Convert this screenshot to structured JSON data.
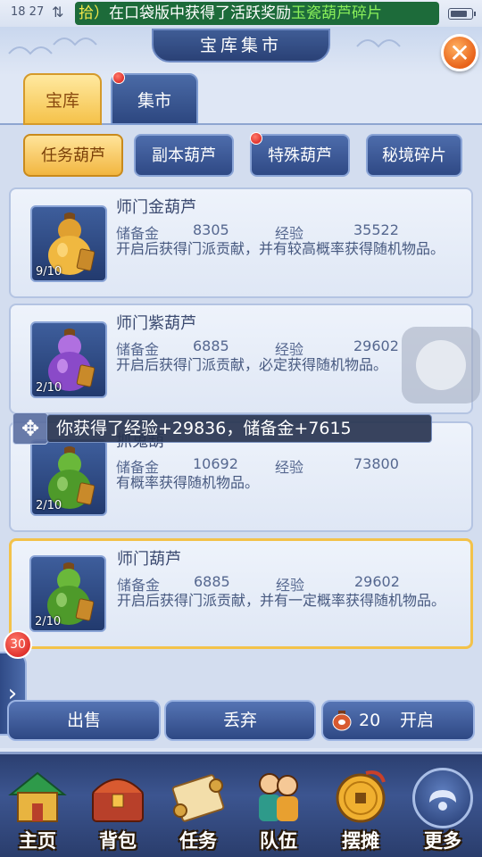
{
  "status_bar": {
    "time": "18 27",
    "network_icon": "updown-arrows-icon",
    "ticker_prefix": "拾）",
    "ticker_main": "在口袋版中获得了活跃奖励",
    "ticker_item": "玉瓷葫芦碎片"
  },
  "header": {
    "title": "宝库集市",
    "close_icon": "close-icon"
  },
  "top_tabs": [
    {
      "label": "宝库",
      "active": true
    },
    {
      "label": "集市",
      "active": false,
      "red_dot": true
    }
  ],
  "sub_tabs": [
    {
      "label": "任务葫芦",
      "active": true
    },
    {
      "label": "副本葫芦",
      "active": false
    },
    {
      "label": "特殊葫芦",
      "active": false,
      "red_dot": true
    },
    {
      "label": "秘境碎片",
      "active": false
    }
  ],
  "items": [
    {
      "name": "师门金葫芦",
      "count": "9/10",
      "reserve_label": "储备金",
      "reserve_value": "8305",
      "exp_label": "经验",
      "exp_value": "35522",
      "desc": "开启后获得门派贡献，并有较高概率获得随机物品。",
      "color": "#e0a030",
      "seal_text": "师"
    },
    {
      "name": "师门紫葫芦",
      "count": "2/10",
      "reserve_label": "储备金",
      "reserve_value": "6885",
      "exp_label": "经验",
      "exp_value": "29602",
      "desc": "开启后获得门派贡献，必定获得随机物品。",
      "color": "#9a5ad0",
      "seal_text": "师"
    },
    {
      "name": "抓鬼葫",
      "count": "2/10",
      "reserve_label": "储备金",
      "reserve_value": "10692",
      "exp_label": "经验",
      "exp_value": "73800",
      "desc": "有概率获得随机物品。",
      "color": "#5aa830",
      "seal_text": "鬼"
    },
    {
      "name": "师门葫芦",
      "count": "2/10",
      "reserve_label": "储备金",
      "reserve_value": "6885",
      "exp_label": "经验",
      "exp_value": "29602",
      "desc": "开启后获得门派贡献，并有一定概率获得随机物品。",
      "color": "#5aa830",
      "seal_text": "师",
      "selected": true
    }
  ],
  "toast": {
    "text": "你获得了经验+29836，储备金+7615",
    "move_icon": "move-arrows-icon"
  },
  "side": {
    "badge": "30",
    "arrow": "›"
  },
  "actions": {
    "sell": "出售",
    "discard": "丢弃",
    "open_count": "20",
    "open": "开启"
  },
  "nav": [
    {
      "label": "主页",
      "icon": "house-icon"
    },
    {
      "label": "背包",
      "icon": "treasure-chest-icon"
    },
    {
      "label": "任务",
      "icon": "scroll-icon"
    },
    {
      "label": "队伍",
      "icon": "team-people-icon"
    },
    {
      "label": "摆摊",
      "icon": "gold-coin-icon"
    },
    {
      "label": "更多",
      "icon": "more-cloud-icon"
    }
  ],
  "colors": {
    "accent_gold": "#f5c24a",
    "nav_blue": "#2b3f70",
    "ticker_green": "#1d6b3a"
  }
}
